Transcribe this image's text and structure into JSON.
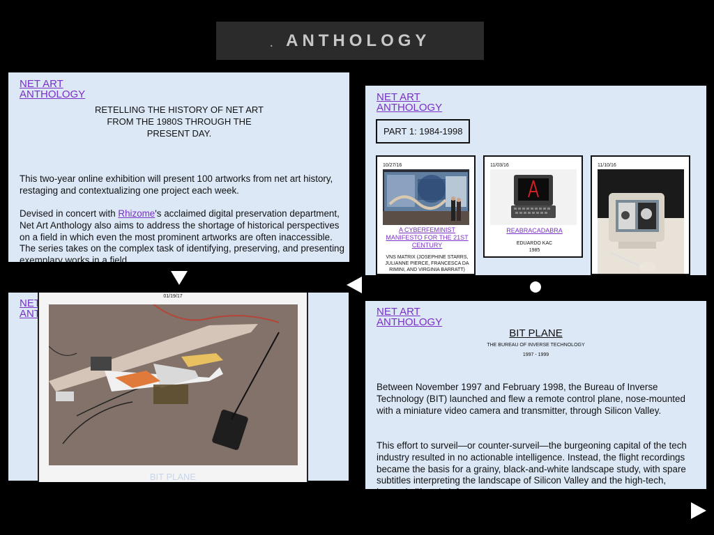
{
  "header": {
    "dot": ".",
    "title": "ANTHOLOGY"
  },
  "logo_line1": "NET ART",
  "logo_line2": "ANTHOLOGY",
  "intro_panel": {
    "tagline": "RETELLING THE HISTORY OF NET ART FROM THE 1980S THROUGH THE PRESENT DAY.",
    "para1": "This two-year online exhibition will present 100 artworks from net art history, restaging and contextualizing one project each week.",
    "para2_prefix": "Devised in concert with ",
    "para2_link": "Rhizome",
    "para2_suffix": "'s acclaimed digital preservation department, Net Art Anthology also aims to address the shortage of historical perspectives on a field in which even the most prominent artworks are often inaccessible. The series takes on the complex task of identifying, preserving, and presenting exemplary works in a field"
  },
  "part_panel": {
    "part_label": "PART 1: 1984-1998",
    "cards": [
      {
        "date": "10/27/16",
        "title": "A CYBERFEMINIST MANIFESTO FOR THE 21ST CENTURY",
        "artist": "VNS MATRIX (JOSEPHINE STARRS, JULIANNE PIERCE, FRANCESCA DA RIMINI, AND VIRGINIA BARRATT)"
      },
      {
        "date": "11/03/16",
        "title": "REABRACADABRA",
        "artist": "EDUARDO KAC",
        "year": "1985"
      },
      {
        "date": "11/10/16",
        "title": "",
        "artist": ""
      }
    ]
  },
  "overlay": {
    "date": "01/19/17",
    "caption": "BIT PLANE"
  },
  "detail_panel": {
    "title": "BIT PLANE",
    "artist": "THE BUREAU OF INVERSE TECHNOLOGY",
    "years": "1997 - 1999",
    "para1": "Between November 1997 and February 1998, the Bureau of Inverse Technology (BIT) launched and flew a remote control plane, nose-mounted with a miniature video camera and transmitter, through Silicon Valley.",
    "para2": "This effort to surveil—or counter-surveil—the burgeoning capital of the tech industry resulted in no actionable intelligence. Instead, the flight recordings became the basis for a grainy, black-and-white landscape study, with spare subtitles interpreting the landscape of Silicon Valley and the high-tech, hermetic lifestyle it fostered."
  },
  "colors": {
    "panel": "#dce8f6",
    "link": "#7a2fc7",
    "background": "#000000"
  }
}
